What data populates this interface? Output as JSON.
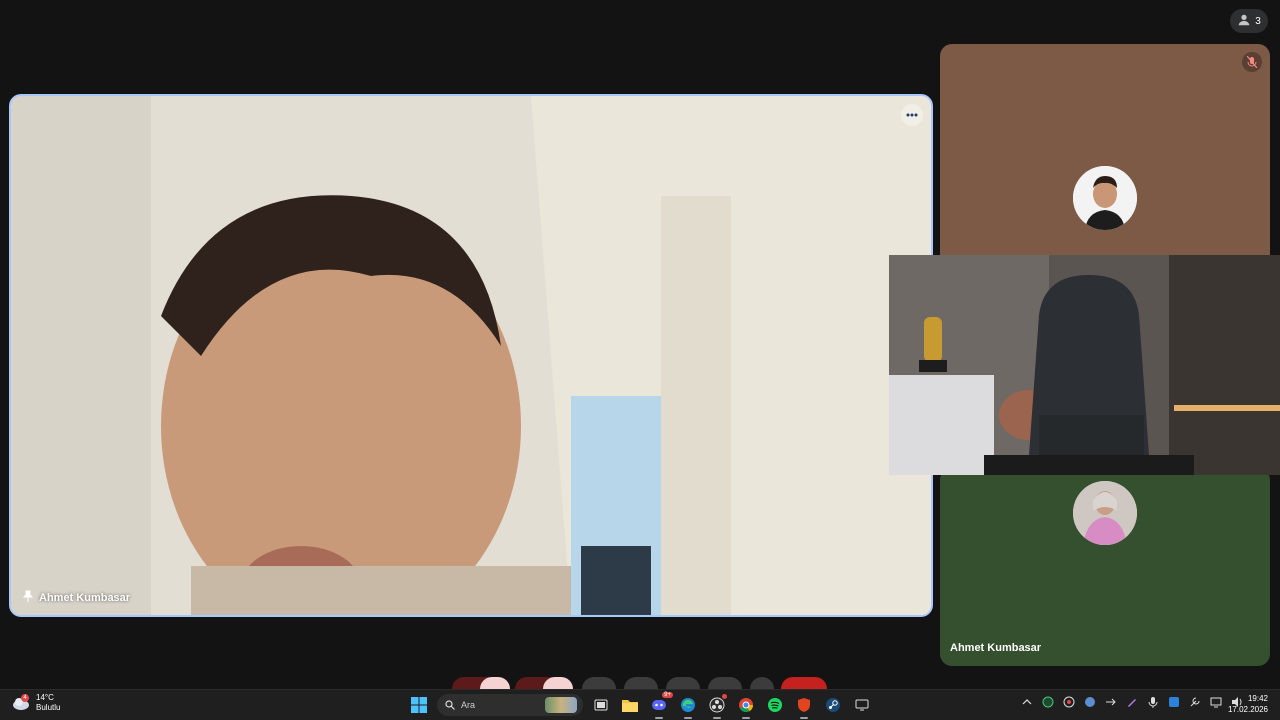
{
  "meeting": {
    "participant_count": "3"
  },
  "main_video": {
    "name": "Ahmet Kumbasar"
  },
  "side_tiles": {
    "green_tile_name": "Ahmet Kumbasar"
  },
  "taskbar": {
    "weather_temp": "14°C",
    "weather_desc": "Bulutlu",
    "weather_badge": "4",
    "search_placeholder": "Ara",
    "discord_badge": "9+",
    "time": "19:42",
    "date": "17.02.2026"
  },
  "colors": {
    "accent_border": "#a8c7fa",
    "brown_tile": "#7c5a45",
    "green_tile": "#34502e",
    "end_call": "#c5221f"
  }
}
